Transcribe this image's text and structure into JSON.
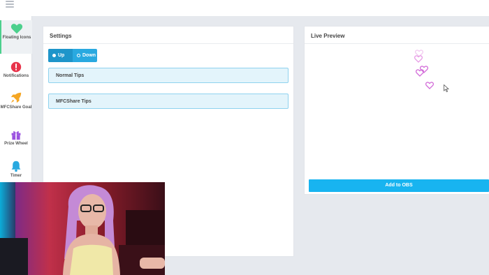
{
  "sidebar": {
    "items": [
      {
        "label": "Floating Icons",
        "icon": "heart-icon",
        "color": "#4cd08d",
        "active": true
      },
      {
        "label": "Notifications",
        "icon": "alert-icon",
        "color": "#e8334a"
      },
      {
        "label": "MFCShare Goal",
        "icon": "rocket-icon",
        "color": "#f5a623"
      },
      {
        "label": "Prize Wheel",
        "icon": "gift-icon",
        "color": "#9b51e0"
      },
      {
        "label": "Timer",
        "icon": "bell-icon",
        "color": "#29a9e0"
      }
    ]
  },
  "settings": {
    "title": "Settings",
    "direction": {
      "options": [
        "Up",
        "Down"
      ],
      "selected": "Up"
    },
    "sections": [
      "Normal Tips",
      "MFCShare Tips"
    ]
  },
  "preview": {
    "title": "Live Preview",
    "button_label": "Add to OBS",
    "heart_color": "#d26ad8"
  },
  "colors": {
    "accent_blue": "#18b4f0",
    "active_green": "#4cd08d"
  }
}
